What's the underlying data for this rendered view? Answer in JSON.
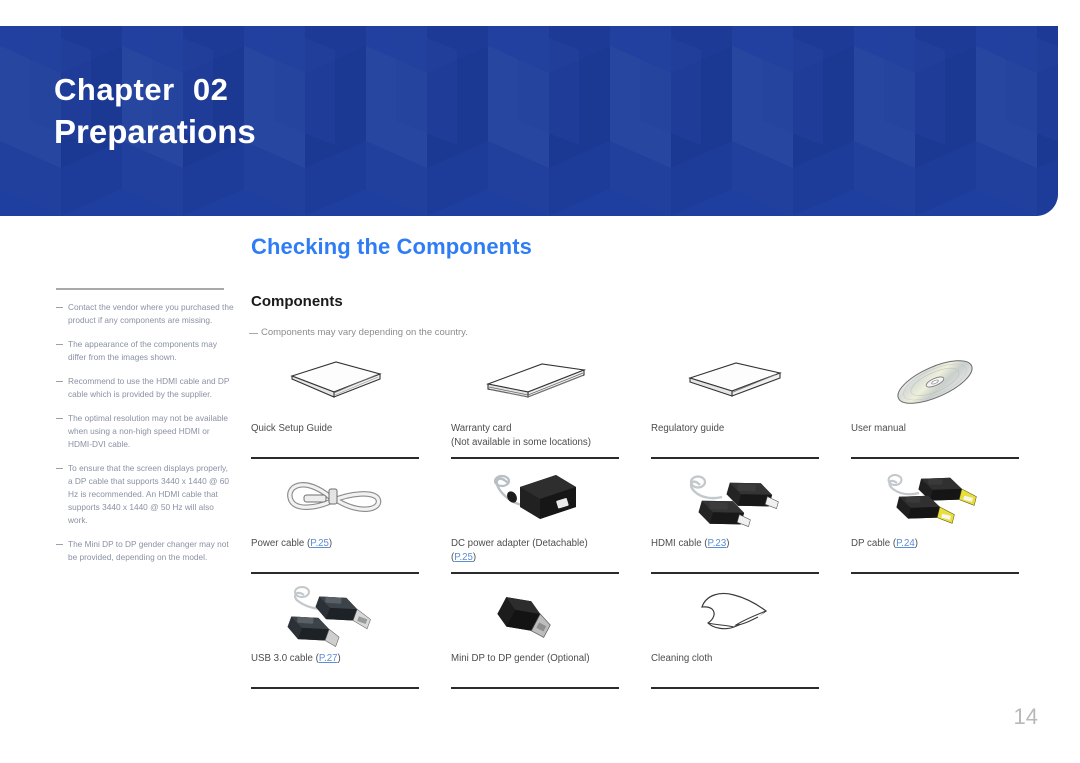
{
  "banner": {
    "chapter_label": "Chapter  02",
    "chapter_title": "Preparations",
    "background_color": "#1f3fa0"
  },
  "section": {
    "title": "Checking the Components",
    "title_color": "#2f7df6",
    "subsection": "Components",
    "note": "Components may vary depending on the country."
  },
  "sidebar": {
    "notes": [
      "Contact the vendor where you purchased the product if any components are missing.",
      "The appearance of the components may differ from the images shown.",
      "Recommend to use the HDMI cable and DP cable which is provided by the supplier.",
      "The optimal resolution may not be available when using a non-high speed HDMI or HDMI-DVI cable.",
      "To ensure that the screen displays properly, a DP cable that supports 3440 x 1440 @ 60 Hz is recommended. An HDMI cable that supports 3440 x 1440 @ 50 Hz will also work.",
      "The Mini DP to DP gender changer may not be provided, depending on the model."
    ]
  },
  "components": {
    "rows": [
      [
        {
          "icon": "quick-setup-guide-icon",
          "label": "Quick Setup Guide",
          "label2": "",
          "ref": "",
          "divider": true
        },
        {
          "icon": "warranty-card-icon",
          "label": "Warranty card",
          "label2": "(Not available in some locations)",
          "ref": "",
          "divider": true
        },
        {
          "icon": "regulatory-guide-icon",
          "label": "Regulatory guide",
          "label2": "",
          "ref": "",
          "divider": true
        },
        {
          "icon": "user-manual-disc-icon",
          "label": "User manual",
          "label2": "",
          "ref": "",
          "divider": true
        }
      ],
      [
        {
          "icon": "power-cable-icon",
          "label": "Power cable (",
          "label2": "",
          "ref": "P.25",
          "divider": true
        },
        {
          "icon": "dc-power-adapter-icon",
          "label": "DC power adapter (Detachable)",
          "label2": "(",
          "ref": "P.25",
          "divider": true
        },
        {
          "icon": "hdmi-cable-icon",
          "label": "HDMI cable (",
          "label2": "",
          "ref": "P.23",
          "divider": true
        },
        {
          "icon": "dp-cable-icon",
          "label": "DP cable (",
          "label2": "",
          "ref": "P.24",
          "divider": true
        }
      ],
      [
        {
          "icon": "usb-cable-icon",
          "label": "USB 3.0 cable (",
          "label2": "",
          "ref": "P.27",
          "divider": true
        },
        {
          "icon": "mini-dp-gender-icon",
          "label": "Mini DP to DP gender (Optional)",
          "label2": "",
          "ref": "",
          "divider": true
        },
        {
          "icon": "cleaning-cloth-icon",
          "label": "Cleaning cloth",
          "label2": "",
          "ref": "",
          "divider": true
        },
        {
          "icon": "",
          "label": "",
          "label2": "",
          "ref": "",
          "divider": false
        }
      ]
    ]
  },
  "footer": {
    "page_number": "14"
  }
}
